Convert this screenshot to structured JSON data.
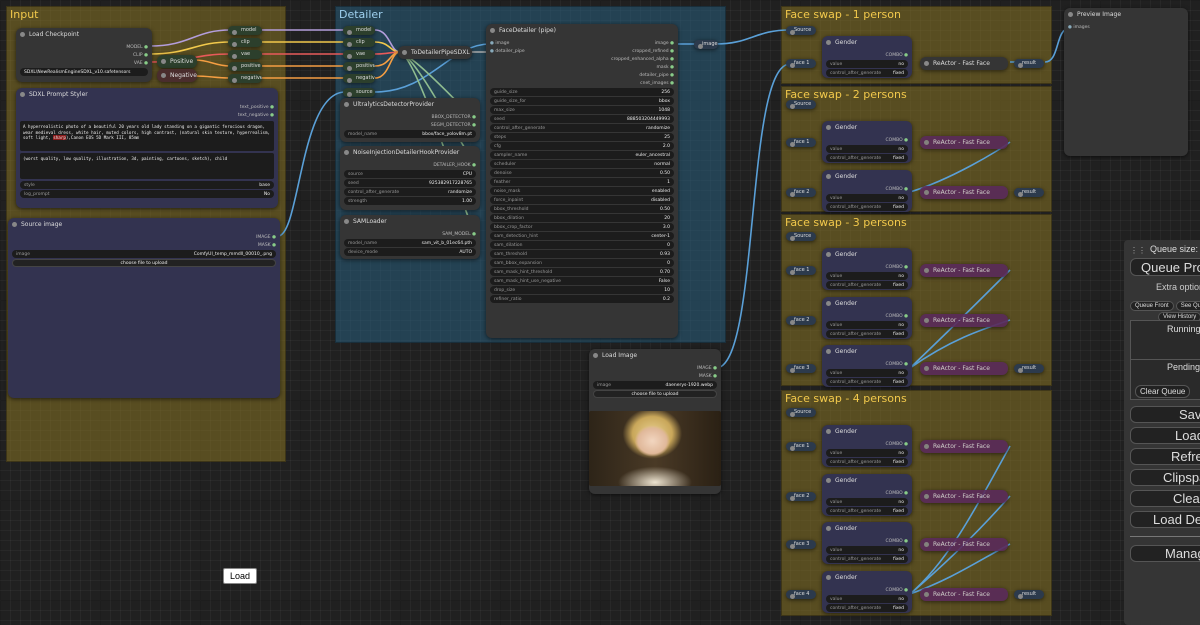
{
  "groups": {
    "input": "Input",
    "detailer": "Detailer",
    "fs1": "Face swap - 1 person",
    "fs2": "Face swap - 2 persons",
    "fs3": "Face swap - 3 persons",
    "fs4": "Face swap - 4 persons"
  },
  "load_checkpoint": {
    "title": "Load Checkpoint",
    "out_model": "MODEL",
    "out_clip": "CLIP",
    "out_vae": "VAE",
    "ckpt_name": "SDXL\\NewRealismEngineSDXL_v10.safetensors"
  },
  "reroute_pos": "Positive",
  "reroute_neg": "Negative",
  "reroutes": [
    "model",
    "clip",
    "vae",
    "positive",
    "negative"
  ],
  "reroutes_det": [
    "model",
    "clip",
    "vae",
    "positive",
    "negative",
    "source"
  ],
  "prompt_styler": {
    "title": "SDXL Prompt Styler",
    "out_pos": "text_positive",
    "out_neg": "text_negative",
    "pos_text_a": "A hyperrealistic photo of a beautiful 20 years old lady standing on a gigantic ferocious dragon, wear medieval dress, white hair, muted colors, high contrast, (natural skin texture, hyperrealism, soft light, ",
    "pos_text_b": "sharp",
    "pos_text_c": "),Canon EOS 5D Mark III, 85mm",
    "neg_text": "(worst quality, low quality, illustration, 3d, painting, cartoons, sketch), child",
    "style_label": "style",
    "style_value": "base",
    "log_label": "log_prompt",
    "log_value": "No"
  },
  "source_image": {
    "title": "Source image",
    "out_image": "IMAGE",
    "out_mask": "MASK",
    "image_label": "image",
    "image_value": "ComfyUI_temp_mmdll_00010_.png",
    "upload": "choose file to upload"
  },
  "to_detailer_pipe": {
    "title": "ToDetailerPipeSDXL"
  },
  "ultralytics": {
    "title": "UltralyticsDetectorProvider",
    "out_bbox": "BBOX_DETECTOR",
    "out_segm": "SEGM_DETECTOR",
    "model_label": "model_name",
    "model_value": "bbox/face_yolov8m.pt"
  },
  "noise_injection": {
    "title": "NoiseInjectionDetailerHookProvider",
    "out": "DETAILER_HOOK",
    "source_label": "source",
    "source_value": "CPU",
    "seed_label": "seed",
    "seed_value": "925382917228765",
    "cag_label": "control_after_generate",
    "cag_value": "randomize",
    "strength_label": "strength",
    "strength_value": "1.00"
  },
  "samloader": {
    "title": "SAMLoader",
    "out": "SAM_MODEL",
    "model_label": "model_name",
    "model_value": "sam_vit_b_01ec64.pth",
    "device_label": "device_mode",
    "device_value": "AUTO"
  },
  "face_detailer": {
    "title": "FaceDetailer (pipe)",
    "in_image": "image",
    "in_pipe": "detailer_pipe",
    "outputs": [
      "image",
      "cropped_refined",
      "cropped_enhanced_alpha",
      "mask",
      "detailer_pipe",
      "cnet_images"
    ],
    "widgets": [
      [
        "guide_size",
        "256"
      ],
      [
        "guide_size_for",
        "bbox"
      ],
      [
        "max_size",
        "1048"
      ],
      [
        "seed",
        "888503204449993"
      ],
      [
        "control_after_generate",
        "randomize"
      ],
      [
        "steps",
        "25"
      ],
      [
        "cfg",
        "2.0"
      ],
      [
        "sampler_name",
        "euler_ancestral"
      ],
      [
        "scheduler",
        "normal"
      ],
      [
        "denoise",
        "0.50"
      ],
      [
        "feather",
        "1"
      ],
      [
        "noise_mask",
        "enabled"
      ],
      [
        "force_inpaint",
        "disabled"
      ],
      [
        "bbox_threshold",
        "0.50"
      ],
      [
        "bbox_dilation",
        "20"
      ],
      [
        "bbox_crop_factor",
        "3.0"
      ],
      [
        "sam_detection_hint",
        "center-1"
      ],
      [
        "sam_dilation",
        "0"
      ],
      [
        "sam_threshold",
        "0.93"
      ],
      [
        "sam_bbox_expansion",
        "0"
      ],
      [
        "sam_mask_hint_threshold",
        "0.70"
      ],
      [
        "sam_mask_hint_use_negative",
        "False"
      ],
      [
        "drop_size",
        "10"
      ],
      [
        "refiner_ratio",
        "0.2"
      ]
    ]
  },
  "reroute_image": "image",
  "load_image": {
    "title": "Load Image",
    "out_image": "IMAGE",
    "out_mask": "MASK",
    "image_label": "image",
    "image_value": "daenerys-1920.webp",
    "upload": "choose file to upload"
  },
  "preview": {
    "title": "Preview Image",
    "in": "images"
  },
  "faceswap": {
    "source": "Source",
    "face1": "face 1",
    "face2": "face 2",
    "face3": "face 3",
    "face4": "face 4",
    "gender": "Gender",
    "combo": "COMBO",
    "value_label": "value",
    "value_val": "no",
    "cag_label": "control_after_generate",
    "cag_val": "fixed",
    "reactor": "ReActor - Fast Face",
    "result": "result"
  },
  "side_panel": {
    "queue_size": "Queue size: 0",
    "queue_prompt": "Queue Prompt",
    "extra_options": "Extra options",
    "queue_front": "Queue Front",
    "see_queue": "See Queue",
    "view_history": "View History",
    "running": "Running",
    "pending": "Pending",
    "clear_queue": "Clear Queue",
    "save": "Save",
    "load": "Load",
    "refresh": "Refresh",
    "clipspace": "Clipspace",
    "clear": "Clear",
    "load_default": "Load Default",
    "manager": "Manager"
  },
  "load_button": "Load"
}
